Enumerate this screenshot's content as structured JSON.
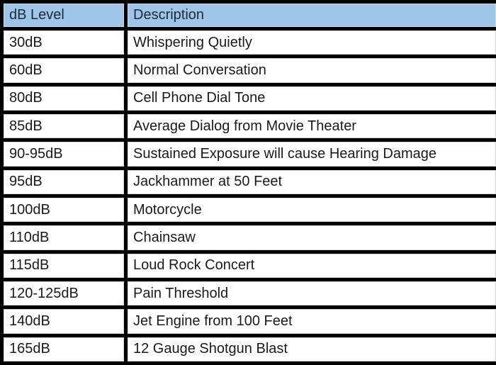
{
  "table": {
    "header": {
      "level": "dB Level",
      "description": "Description"
    },
    "header_color": "#9fc5e8",
    "border_color": "#000000",
    "rows": [
      {
        "level": "30dB",
        "description": "Whispering Quietly"
      },
      {
        "level": "60dB",
        "description": "Normal Conversation"
      },
      {
        "level": "80dB",
        "description": "Cell Phone Dial Tone"
      },
      {
        "level": "85dB",
        "description": "Average Dialog from Movie Theater"
      },
      {
        "level": "90-95dB",
        "description": "Sustained Exposure will cause Hearing Damage"
      },
      {
        "level": "95dB",
        "description": "Jackhammer at 50 Feet"
      },
      {
        "level": "100dB",
        "description": "Motorcycle"
      },
      {
        "level": "110dB",
        "description": "Chainsaw"
      },
      {
        "level": "115dB",
        "description": "Loud Rock Concert"
      },
      {
        "level": "120-125dB",
        "description": "Pain Threshold"
      },
      {
        "level": "140dB",
        "description": "Jet Engine from 100 Feet"
      },
      {
        "level": "165dB",
        "description": "12 Gauge Shotgun Blast"
      }
    ]
  }
}
